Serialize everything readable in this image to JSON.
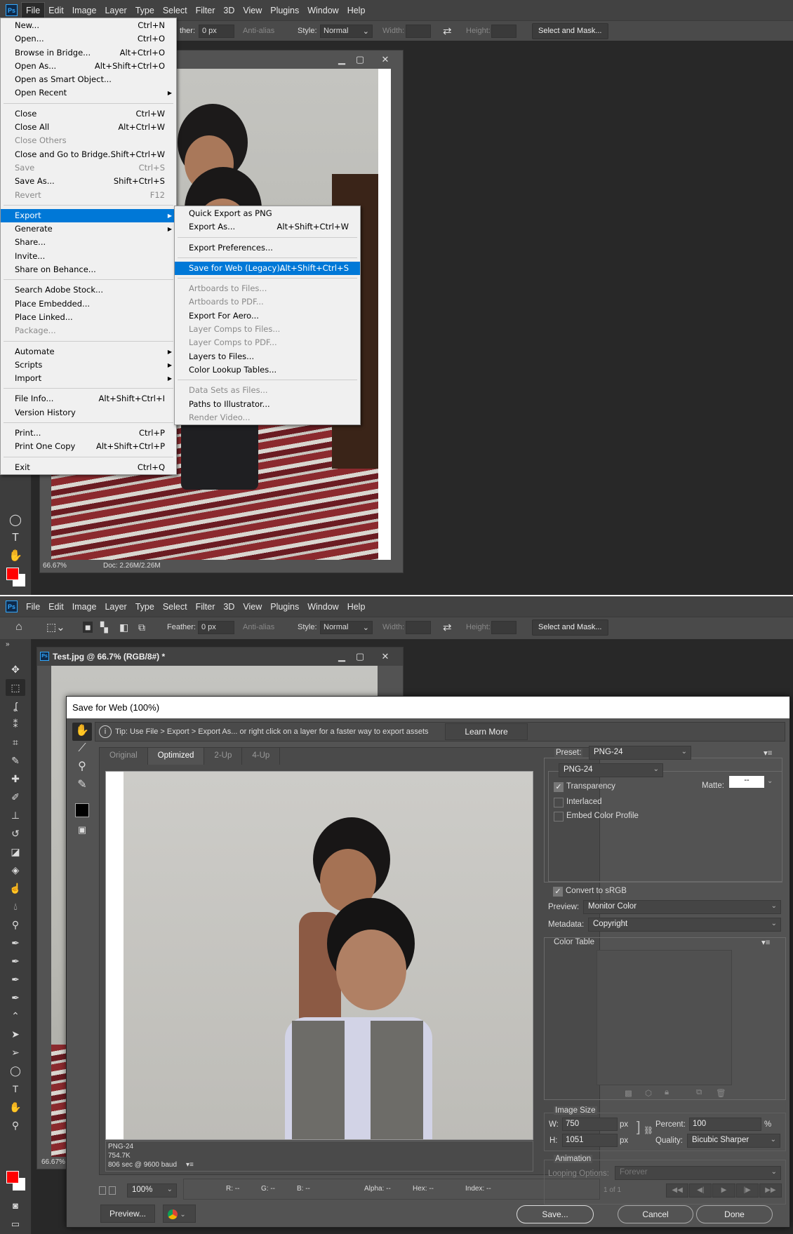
{
  "app": {
    "logo": "Ps",
    "menubar": [
      "File",
      "Edit",
      "Image",
      "Layer",
      "Type",
      "Select",
      "Filter",
      "3D",
      "View",
      "Plugins",
      "Window",
      "Help"
    ]
  },
  "options_top": {
    "feather_label": "ther:",
    "feather_value": "0 px",
    "anti_alias": "Anti-alias",
    "style_label": "Style:",
    "style_value": "Normal",
    "width_label": "Width:",
    "height_label": "Height:",
    "select_mask": "Select and Mask..."
  },
  "options_bottom": {
    "feather_label": "Feather:",
    "feather_value": "0 px",
    "anti_alias": "Anti-alias",
    "style_label": "Style:",
    "style_value": "Normal",
    "width_label": "Width:",
    "height_label": "Height:",
    "select_mask": "Select and Mask..."
  },
  "file_menu": [
    {
      "label": "New...",
      "shortcut": "Ctrl+N"
    },
    {
      "label": "Open...",
      "shortcut": "Ctrl+O"
    },
    {
      "label": "Browse in Bridge...",
      "shortcut": "Alt+Ctrl+O"
    },
    {
      "label": "Open As...",
      "shortcut": "Alt+Shift+Ctrl+O"
    },
    {
      "label": "Open as Smart Object..."
    },
    {
      "label": "Open Recent",
      "submenu": true
    },
    {
      "sep": true
    },
    {
      "label": "Close",
      "shortcut": "Ctrl+W"
    },
    {
      "label": "Close All",
      "shortcut": "Alt+Ctrl+W"
    },
    {
      "label": "Close Others",
      "disabled": true
    },
    {
      "label": "Close and Go to Bridge...",
      "shortcut": "Shift+Ctrl+W"
    },
    {
      "label": "Save",
      "shortcut": "Ctrl+S",
      "disabled": true
    },
    {
      "label": "Save As...",
      "shortcut": "Shift+Ctrl+S"
    },
    {
      "label": "Revert",
      "shortcut": "F12",
      "disabled": true
    },
    {
      "sep": true
    },
    {
      "label": "Export",
      "submenu": true,
      "highlighted": true
    },
    {
      "label": "Generate",
      "submenu": true
    },
    {
      "label": "Share..."
    },
    {
      "label": "Invite..."
    },
    {
      "label": "Share on Behance..."
    },
    {
      "sep": true
    },
    {
      "label": "Search Adobe Stock..."
    },
    {
      "label": "Place Embedded..."
    },
    {
      "label": "Place Linked..."
    },
    {
      "label": "Package...",
      "disabled": true
    },
    {
      "sep": true
    },
    {
      "label": "Automate",
      "submenu": true
    },
    {
      "label": "Scripts",
      "submenu": true
    },
    {
      "label": "Import",
      "submenu": true
    },
    {
      "sep": true
    },
    {
      "label": "File Info...",
      "shortcut": "Alt+Shift+Ctrl+I"
    },
    {
      "label": "Version History"
    },
    {
      "sep": true
    },
    {
      "label": "Print...",
      "shortcut": "Ctrl+P"
    },
    {
      "label": "Print One Copy",
      "shortcut": "Alt+Shift+Ctrl+P"
    },
    {
      "sep": true
    },
    {
      "label": "Exit",
      "shortcut": "Ctrl+Q"
    }
  ],
  "export_menu": [
    {
      "label": "Quick Export as PNG"
    },
    {
      "label": "Export As...",
      "shortcut": "Alt+Shift+Ctrl+W"
    },
    {
      "sep": true
    },
    {
      "label": "Export Preferences..."
    },
    {
      "sep": true
    },
    {
      "label": "Save for Web (Legacy)...",
      "shortcut": "Alt+Shift+Ctrl+S",
      "highlighted": true
    },
    {
      "sep": true
    },
    {
      "label": "Artboards to Files...",
      "disabled": true
    },
    {
      "label": "Artboards to PDF...",
      "disabled": true
    },
    {
      "label": "Export For Aero..."
    },
    {
      "label": "Layer Comps to Files...",
      "disabled": true
    },
    {
      "label": "Layer Comps to PDF...",
      "disabled": true
    },
    {
      "label": "Layers to Files..."
    },
    {
      "label": "Color Lookup Tables..."
    },
    {
      "sep": true
    },
    {
      "label": "Data Sets as Files...",
      "disabled": true
    },
    {
      "label": "Paths to Illustrator..."
    },
    {
      "label": "Render Video...",
      "disabled": true
    }
  ],
  "doc_top": {
    "zoom": "66.67%",
    "doc_size": "Doc: 2.26M/2.26M"
  },
  "doc_bottom": {
    "title": "Test.jpg @ 66.7% (RGB/8#) *",
    "zoom": "66.67%"
  },
  "colors": {
    "foreground": "#ff0000",
    "background": "#ffffff",
    "highlight": "#0078d7"
  },
  "dialog": {
    "title": "Save for Web (100%)",
    "tip": "Tip: Use File > Export > Export As...  or right click on a layer for a faster way to export assets",
    "learn_more": "Learn More",
    "tabs": [
      {
        "label": "Original"
      },
      {
        "label": "Optimized",
        "active": true
      },
      {
        "label": "2-Up"
      },
      {
        "label": "4-Up"
      }
    ],
    "info": {
      "format": "PNG-24",
      "size": "754.7K",
      "time": "806 sec @ 9600 baud"
    },
    "zoom": "100%",
    "readout": {
      "r": "R: --",
      "g": "G: --",
      "b": "B: --",
      "alpha": "Alpha: --",
      "hex": "Hex: --",
      "index": "Index: --"
    },
    "preview_button": "Preview...",
    "preset_label": "Preset:",
    "preset_value": "PNG-24",
    "format_value": "PNG-24",
    "transparency": {
      "label": "Transparency",
      "checked": true
    },
    "interlaced": {
      "label": "Interlaced",
      "checked": false
    },
    "embed_profile": {
      "label": "Embed Color Profile",
      "checked": false
    },
    "matte_label": "Matte:",
    "matte_value": "--",
    "convert_srgb": {
      "label": "Convert to sRGB",
      "checked": true
    },
    "preview_label": "Preview:",
    "preview_value": "Monitor Color",
    "metadata_label": "Metadata:",
    "metadata_value": "Copyright",
    "color_table_label": "Color Table",
    "image_size_label": "Image Size",
    "w_label": "W:",
    "w_value": "750",
    "h_label": "H:",
    "h_value": "1051",
    "unit": "px",
    "percent_label": "Percent:",
    "percent_value": "100",
    "percent_unit": "%",
    "quality_label": "Quality:",
    "quality_value": "Bicubic Sharper",
    "animation_label": "Animation",
    "looping_label": "Looping Options:",
    "looping_value": "Forever",
    "frame_counter": "1 of 1",
    "save": "Save...",
    "cancel": "Cancel",
    "done": "Done"
  }
}
